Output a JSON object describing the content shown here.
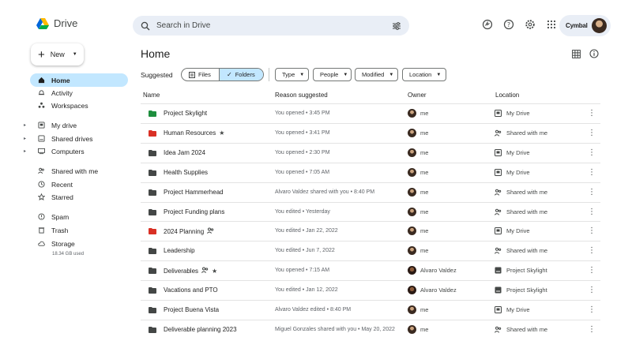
{
  "app": {
    "name": "Drive"
  },
  "search": {
    "placeholder": "Search in Drive"
  },
  "account": {
    "brand": "Cymbal"
  },
  "sidebar": {
    "new_label": "New",
    "items": [
      {
        "label": "Home",
        "icon": "home-icon",
        "active": true
      },
      {
        "label": "Activity",
        "icon": "bell-icon"
      },
      {
        "label": "Workspaces",
        "icon": "workspaces-icon"
      },
      {
        "label": "My drive",
        "icon": "drive-icon",
        "expandable": true
      },
      {
        "label": "Shared drives",
        "icon": "shared-drive-icon",
        "expandable": true
      },
      {
        "label": "Computers",
        "icon": "computer-icon",
        "expandable": true
      },
      {
        "label": "Shared with me",
        "icon": "people-icon"
      },
      {
        "label": "Recent",
        "icon": "clock-icon"
      },
      {
        "label": "Starred",
        "icon": "star-icon"
      },
      {
        "label": "Spam",
        "icon": "spam-icon"
      },
      {
        "label": "Trash",
        "icon": "trash-icon"
      },
      {
        "label": "Storage",
        "icon": "cloud-icon"
      }
    ],
    "storage_used": "18.34 GB used"
  },
  "main": {
    "title": "Home",
    "suggested_label": "Suggested",
    "toggle": {
      "files": "Files",
      "folders": "Folders",
      "selected": "Folders"
    },
    "filters": [
      "Type",
      "People",
      "Modified",
      "Location"
    ],
    "columns": {
      "name": "Name",
      "reason": "Reason suggested",
      "owner": "Owner",
      "location": "Location"
    },
    "rows": [
      {
        "name": "Project Skylight",
        "folder_color": "#1e8e3e",
        "shared": false,
        "starred": false,
        "reason": "You opened • 3:45 PM",
        "owner": "me",
        "owner_type": "me",
        "location": "My Drive",
        "loc_icon": "drive"
      },
      {
        "name": "Human Resources",
        "folder_color": "#d93025",
        "shared": false,
        "starred": true,
        "reason": "You opened • 3:41 PM",
        "owner": "me",
        "owner_type": "me",
        "location": "Shared with me",
        "loc_icon": "people"
      },
      {
        "name": "Idea Jam 2024",
        "folder_color": "#444746",
        "shared": false,
        "starred": false,
        "reason": "You opened • 2:30 PM",
        "owner": "me",
        "owner_type": "me",
        "location": "My Drive",
        "loc_icon": "drive"
      },
      {
        "name": "Health Supplies",
        "folder_color": "#444746",
        "shared": false,
        "starred": false,
        "reason": "You opened • 7:05 AM",
        "owner": "me",
        "owner_type": "me",
        "location": "My Drive",
        "loc_icon": "drive"
      },
      {
        "name": "Project Hammerhead",
        "folder_color": "#444746",
        "shared": false,
        "starred": false,
        "reason": "Alvaro Valdez shared with you • 8:40 PM",
        "owner": "me",
        "owner_type": "me",
        "location": "Shared with me",
        "loc_icon": "people"
      },
      {
        "name": "Project Funding plans",
        "folder_color": "#444746",
        "shared": false,
        "starred": false,
        "reason": "You edited • Yesterday",
        "owner": "me",
        "owner_type": "me",
        "location": "Shared with me",
        "loc_icon": "people"
      },
      {
        "name": "2024 Planning",
        "folder_color": "#d93025",
        "shared": true,
        "starred": false,
        "reason": "You edited • Jan 22, 2022",
        "owner": "me",
        "owner_type": "me",
        "location": "My Drive",
        "loc_icon": "drive"
      },
      {
        "name": "Leadership",
        "folder_color": "#444746",
        "shared": false,
        "starred": false,
        "reason": "You edited • Jun 7, 2022",
        "owner": "me",
        "owner_type": "me",
        "location": "Shared with me",
        "loc_icon": "people"
      },
      {
        "name": "Deliverables",
        "folder_color": "#444746",
        "shared": true,
        "starred": true,
        "reason": "You opened • 7:15 AM",
        "owner": "Alvaro Valdez",
        "owner_type": "av",
        "location": "Project Skylight",
        "loc_icon": "shared-drive"
      },
      {
        "name": "Vacations and PTO",
        "folder_color": "#444746",
        "shared": false,
        "starred": false,
        "reason": "You edited • Jan 12, 2022",
        "owner": "Alvaro Valdez",
        "owner_type": "av",
        "location": "Project Skylight",
        "loc_icon": "shared-drive"
      },
      {
        "name": "Project Buena Vista",
        "folder_color": "#444746",
        "shared": false,
        "starred": false,
        "reason": "Alvaro Valdez edited • 8:40 PM",
        "owner": "me",
        "owner_type": "me",
        "location": "My Drive",
        "loc_icon": "drive"
      },
      {
        "name": "Deliverable planning 2023",
        "folder_color": "#444746",
        "shared": false,
        "starred": false,
        "reason": "Miguel Gonzales shared with you • May 20, 2022",
        "owner": "me",
        "owner_type": "me",
        "location": "Shared with me",
        "loc_icon": "people"
      }
    ]
  }
}
